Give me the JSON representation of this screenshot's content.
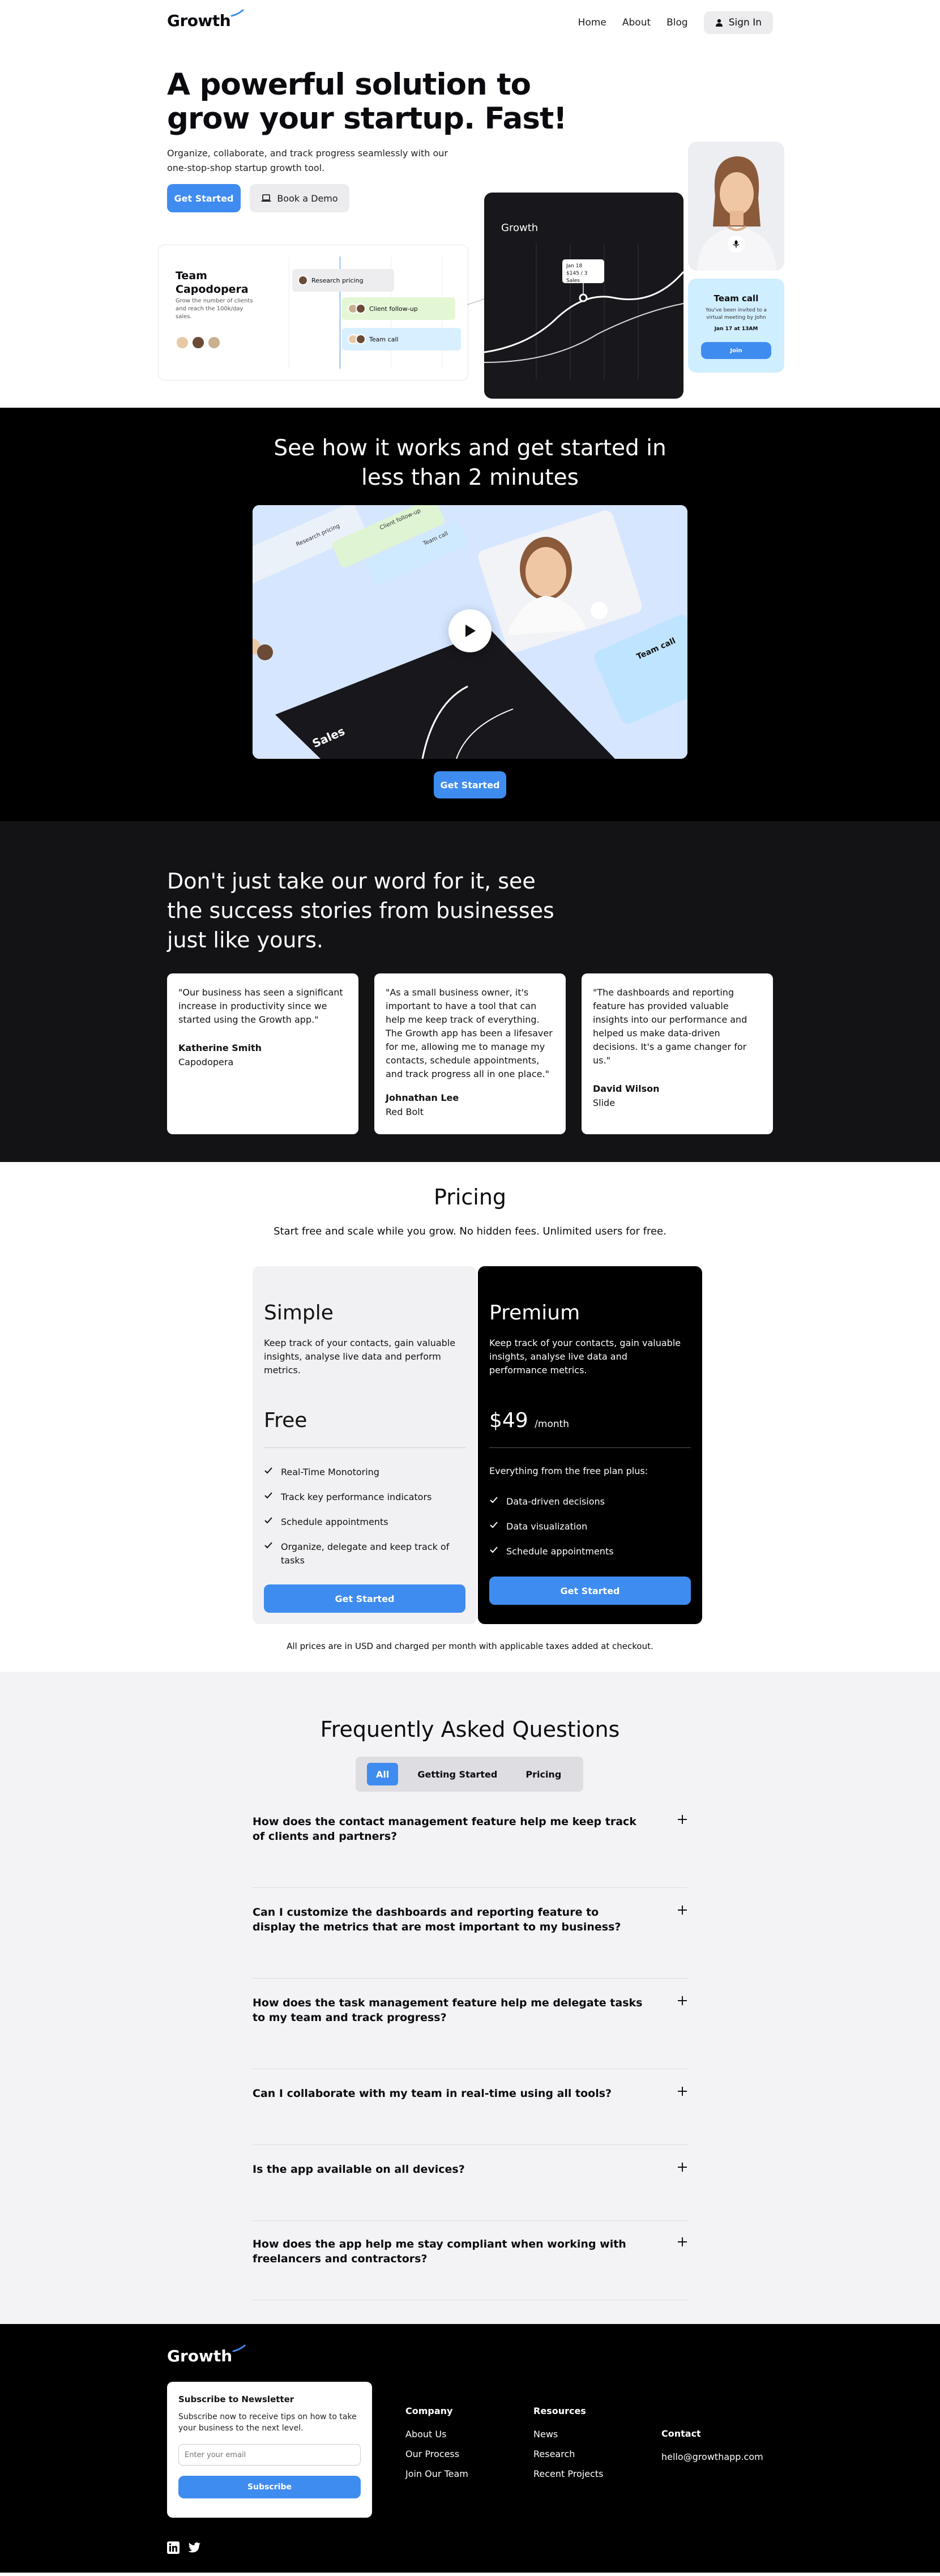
{
  "nav": {
    "logo": "Growth",
    "links": [
      "Home",
      "About",
      "Blog"
    ],
    "signin": "Sign In"
  },
  "hero": {
    "title": "A powerful solution to grow your startup. Fast!",
    "subtitle": "Organize, collaborate, and track progress seamlessly with our one-stop-shop startup growth tool.",
    "primary_cta": "Get Started",
    "secondary_cta": "Book a Demo",
    "task_card": {
      "title": "Team Capodopera",
      "description": "Grow the number of clients and reach the 100k/day sales.",
      "tasks": [
        "Research pricing",
        "Client follow-up",
        "Team call"
      ]
    },
    "chart_card": {
      "title": "Growth",
      "tooltip_date": "Jan 18",
      "tooltip_value": "$145 / 3 Sales"
    },
    "call_card": {
      "title": "Team call",
      "description": "You've been invited to a virtual meeting by John",
      "time": "Jan 17 at 13AM",
      "join": "Join"
    }
  },
  "how": {
    "title": "See how it works and get started in less than 2 minutes",
    "video_labels": [
      "Research pricing",
      "Client follow-up",
      "Team call",
      "Team call",
      "Sales"
    ],
    "cta": "Get Started"
  },
  "testimonials": {
    "title": "Don't just take our word for it, see the success stories from businesses just like yours.",
    "items": [
      {
        "quote": "\"Our business has seen a significant increase in productivity since we started using the Growth app.\"",
        "name": "Katherine Smith",
        "company": "Capodopera"
      },
      {
        "quote": "\"As a small business owner, it's important to have a tool that can help me keep track of everything. The Growth app has been a lifesaver for me, allowing me to manage my contacts, schedule appointments, and track progress all in one place.\"",
        "name": "Johnathan Lee",
        "company": "Red Bolt"
      },
      {
        "quote": "\"The dashboards and reporting feature has provided valuable insights into our performance and helped us make data-driven decisions. It's a game changer for us.\"",
        "name": "David Wilson",
        "company": "Slide"
      }
    ]
  },
  "pricing": {
    "title": "Pricing",
    "subtitle": "Start free and scale while you grow. No hidden fees. Unlimited users for free.",
    "plans": [
      {
        "name": "Simple",
        "description": "Keep track of your contacts, gain valuable insights, analyse live data and perform metrics.",
        "price": "Free",
        "per": "",
        "intro": "",
        "features": [
          "Real-Time Monotoring",
          "Track key performance indicators",
          "Schedule appointments",
          "Organize, delegate and keep track of tasks"
        ],
        "cta": "Get Started"
      },
      {
        "name": "Premium",
        "description": "Keep track of your contacts, gain valuable insights, analyse live data and performance metrics.",
        "price": "$49",
        "per": "/month",
        "intro": "Everything from the free plan plus:",
        "features": [
          "Data-driven decisions",
          "Data visualization",
          "Schedule appointments"
        ],
        "cta": "Get Started"
      }
    ],
    "note": "All prices are in USD and charged per month with applicable taxes added at checkout."
  },
  "faq": {
    "title": "Frequently Asked Questions",
    "tabs": [
      "All",
      "Getting Started",
      "Pricing"
    ],
    "active_tab": "All",
    "items": [
      "How does the contact management feature help me keep track of clients and partners?",
      "Can I customize the dashboards and reporting feature to display the metrics that are most important to my business?",
      "How does the task management feature help me delegate tasks to my team and track progress?",
      "Can I collaborate with my team in real-time using all tools?",
      "Is the app available on all devices?",
      "How does the app help me stay compliant when working with freelancers and contractors?"
    ]
  },
  "footer": {
    "logo": "Growth",
    "newsletter": {
      "title": "Subscribe to Newsletter",
      "description": "Subscribe now to receive tips on how to take your business to the next level.",
      "placeholder": "Enter your email",
      "button": "Subscribe"
    },
    "company": {
      "heading": "Company",
      "links": [
        "About Us",
        "Our Process",
        "Join Our Team"
      ]
    },
    "resources": {
      "heading": "Resources",
      "links": [
        "News",
        "Research",
        "Recent Projects"
      ]
    },
    "contact": {
      "heading": "Contact",
      "email": "hello@growthapp.com"
    }
  },
  "colors": {
    "accent": "#3f8cf0",
    "dark": "#000000",
    "card_dark": "#17171c",
    "light_bg": "#f3f3f5"
  }
}
